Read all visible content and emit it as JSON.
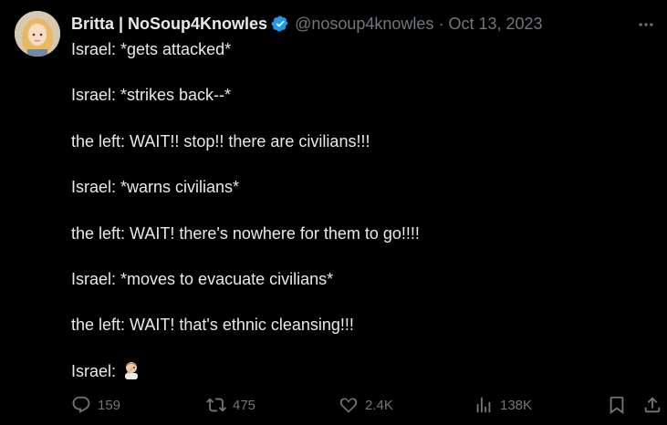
{
  "author": {
    "display_name": "Britta | NoSoup4Knowles",
    "handle": "@nosoup4knowles",
    "separator": "·",
    "date": "Oct 13, 2023",
    "verified": true
  },
  "tweet": {
    "lines": [
      "Israel: *gets attacked*",
      "Israel: *strikes back--*",
      "the left: WAIT!! stop!! there are civilians!!!",
      "Israel: *warns civilians*",
      "the left: WAIT! there's nowhere for them to go!!!!",
      "Israel: *moves to evacuate civilians*",
      "the left: WAIT! that's ethnic cleansing!!!",
      "Israel:"
    ],
    "final_emoji": "man-facepalming-emoji"
  },
  "actions": {
    "replies": "159",
    "reposts": "475",
    "likes": "2.4K",
    "views": "138K"
  },
  "colors": {
    "background": "#000000",
    "text": "#e7e9ea",
    "muted": "#71767b",
    "verified": "#1d9bf0"
  },
  "icons": [
    "verified-badge-icon",
    "more-icon",
    "reply-icon",
    "repost-icon",
    "like-icon",
    "views-icon",
    "bookmark-icon",
    "share-icon"
  ]
}
